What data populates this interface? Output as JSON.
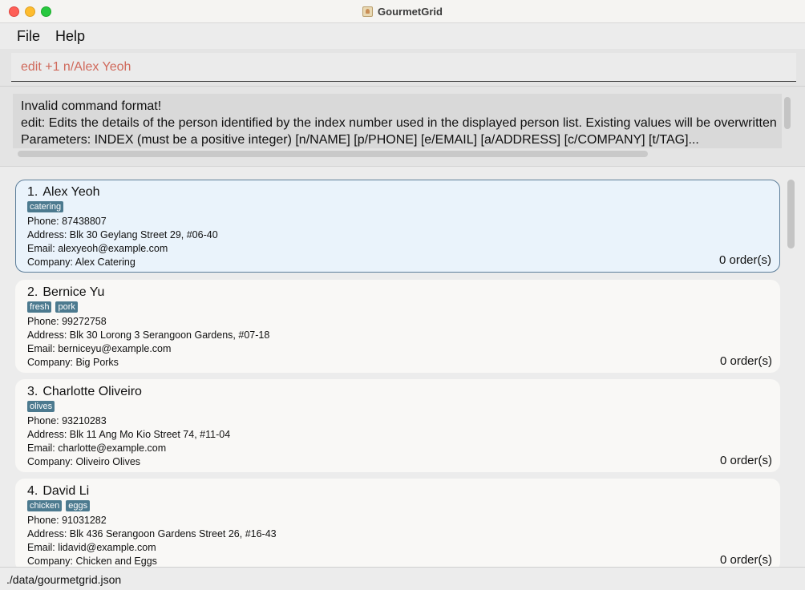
{
  "window": {
    "title": "GourmetGrid"
  },
  "menu": {
    "items": [
      "File",
      "Help"
    ]
  },
  "command": {
    "value": "edit +1 n/Alex Yeoh"
  },
  "result": {
    "lines": [
      "Invalid command format!",
      "edit: Edits the details of the person identified by the index number used in the displayed person list. Existing values will be overwritten",
      "Parameters: INDEX (must be a positive integer) [n/NAME] [p/PHONE] [e/EMAIL] [a/ADDRESS] [c/COMPANY] [t/TAG]..."
    ]
  },
  "persons": [
    {
      "index": "1.",
      "name": "Alex Yeoh",
      "tags": [
        "catering"
      ],
      "phone": "Phone: 87438807",
      "address": "Address: Blk 30 Geylang Street 29, #06-40",
      "email": "Email: alexyeoh@example.com",
      "company": "Company: Alex Catering",
      "orders": "0 order(s)",
      "selected": true
    },
    {
      "index": "2.",
      "name": "Bernice Yu",
      "tags": [
        "fresh",
        "pork"
      ],
      "phone": "Phone: 99272758",
      "address": "Address: Blk 30 Lorong 3 Serangoon Gardens, #07-18",
      "email": "Email: berniceyu@example.com",
      "company": "Company: Big Porks",
      "orders": "0 order(s)",
      "selected": false
    },
    {
      "index": "3.",
      "name": "Charlotte Oliveiro",
      "tags": [
        "olives"
      ],
      "phone": "Phone: 93210283",
      "address": "Address: Blk 11 Ang Mo Kio Street 74, #11-04",
      "email": "Email: charlotte@example.com",
      "company": "Company: Oliveiro Olives",
      "orders": "0 order(s)",
      "selected": false
    },
    {
      "index": "4.",
      "name": "David Li",
      "tags": [
        "chicken",
        "eggs"
      ],
      "phone": "Phone: 91031282",
      "address": "Address: Blk 436 Serangoon Gardens Street 26, #16-43",
      "email": "Email: lidavid@example.com",
      "company": "Company: Chicken and Eggs",
      "orders": "0 order(s)",
      "selected": false
    }
  ],
  "status": {
    "path": "./data/gourmetgrid.json"
  }
}
